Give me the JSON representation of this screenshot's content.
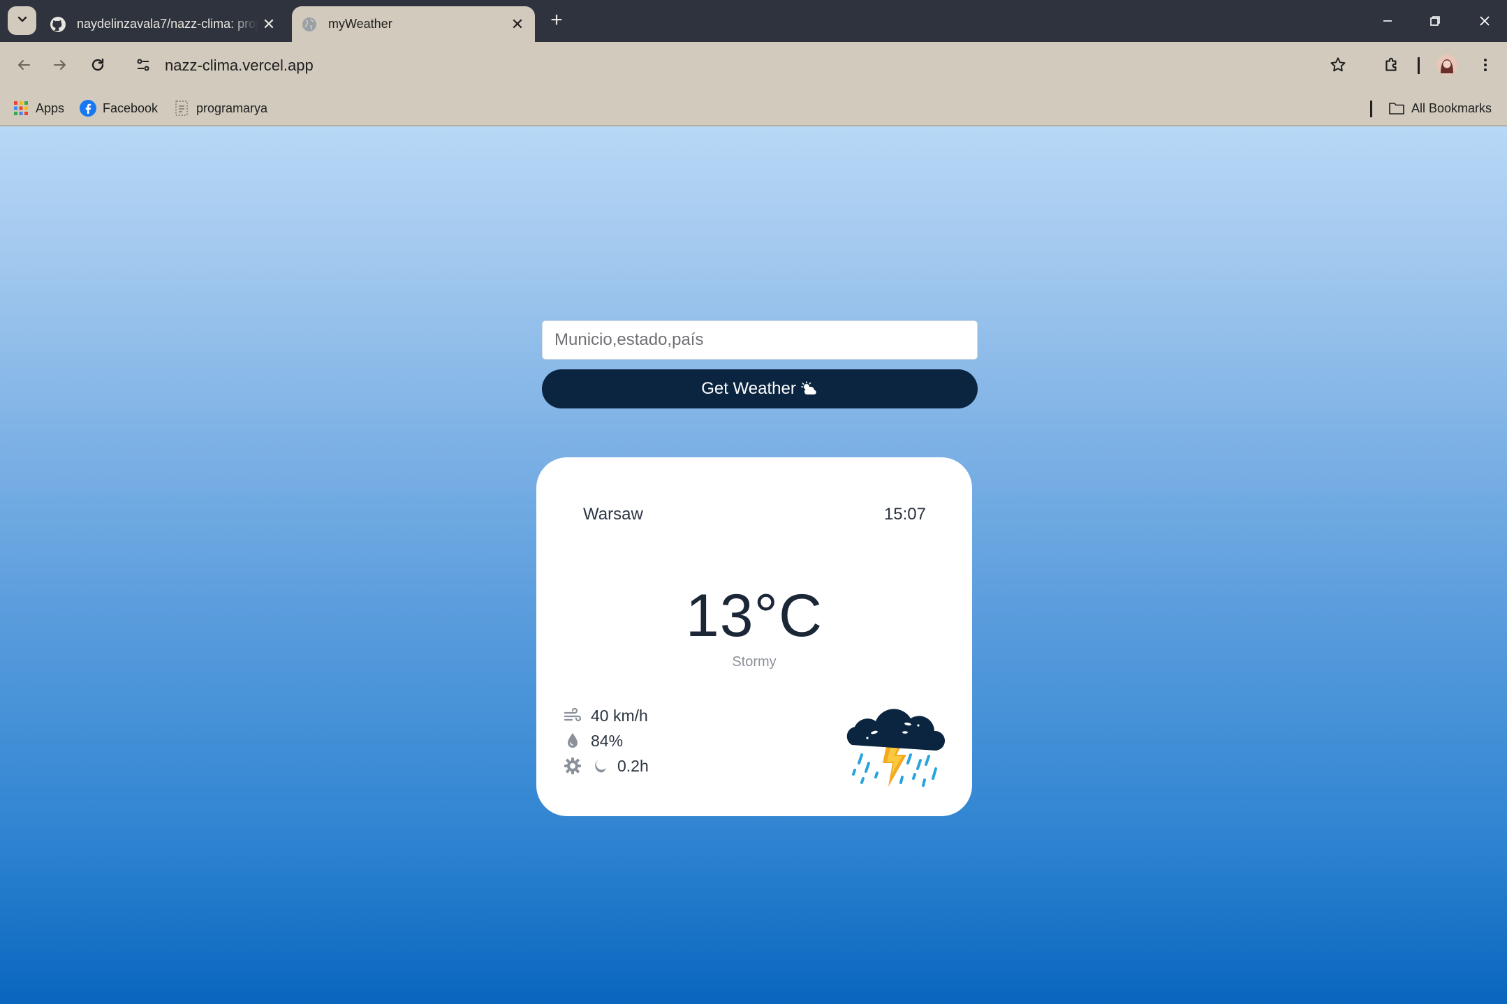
{
  "browser": {
    "tabs": [
      {
        "title": "naydelinzavala7/nazz-clima: project",
        "favicon": "github-icon",
        "active": false
      },
      {
        "title": "myWeather",
        "favicon": "globe-icon",
        "active": true
      }
    ],
    "address": "nazz-clima.vercel.app",
    "bookmarks": [
      {
        "label": "Apps",
        "icon": "apps-grid-icon"
      },
      {
        "label": "Facebook",
        "icon": "facebook-icon"
      },
      {
        "label": "programarya",
        "icon": "page-icon"
      }
    ],
    "all_bookmarks_label": "All Bookmarks"
  },
  "search": {
    "placeholder": "Municio,estado,país",
    "value": ""
  },
  "button": {
    "label": "Get Weather"
  },
  "weather": {
    "city": "Warsaw",
    "time": "15:07",
    "temperature": "13°C",
    "condition": "Stormy",
    "wind": "40 km/h",
    "humidity": "84%",
    "daylight": "0.2h",
    "illustration": "storm-cloud-lightning-icon"
  },
  "colors": {
    "button_bg": "#0b2540",
    "gradient_top": "#b8d8f6",
    "gradient_bottom": "#0965bd",
    "browser_chrome": "#d2cabd",
    "tabstrip": "#2e333d"
  }
}
